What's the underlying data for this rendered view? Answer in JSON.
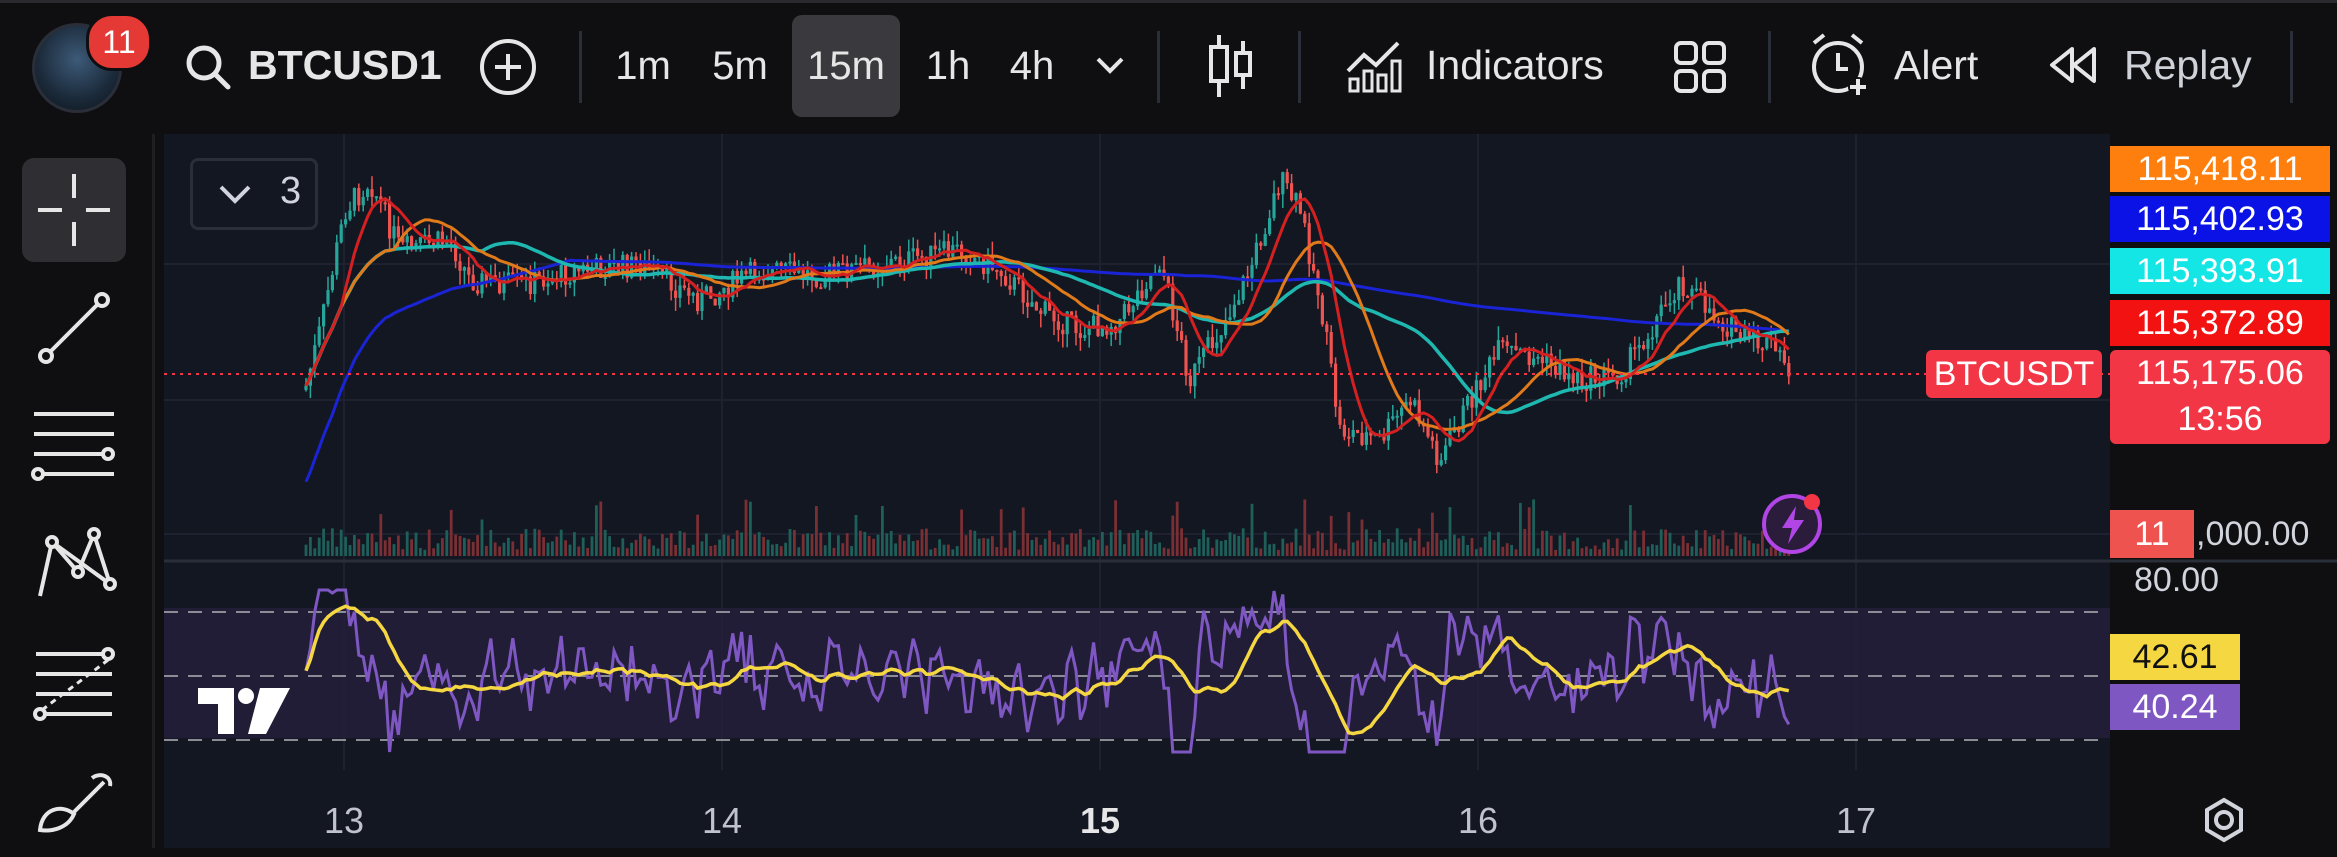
{
  "topbar": {
    "notification_count": "11",
    "symbol": "BTCUSD1",
    "timeframes": [
      "1m",
      "5m",
      "15m",
      "1h",
      "4h"
    ],
    "active_timeframe": "15m",
    "indicators_label": "Indicators",
    "alert_label": "Alert",
    "replay_label": "Replay"
  },
  "chart": {
    "indicator_count": "3",
    "symbol_tag": "BTCUSDT",
    "countdown": "13:56",
    "volume_badge": "11",
    "volume_axis_label": ",000.00",
    "rsi_top_level": "80.00",
    "x_labels": [
      "13",
      "14",
      "15",
      "16",
      "17"
    ],
    "price_labels": [
      {
        "value": "115,418.11",
        "color": "#ff7f0e"
      },
      {
        "value": "115,402.93",
        "color": "#0a12e6"
      },
      {
        "value": "115,393.91",
        "color": "#14e6e6"
      },
      {
        "value": "115,372.89",
        "color": "#f21212"
      },
      {
        "value": "115,175.06",
        "color": "#f23645"
      }
    ],
    "rsi_labels": [
      {
        "value": "42.61",
        "color": "#f5d742"
      },
      {
        "value": "40.24",
        "color": "#7e57c2"
      }
    ]
  }
}
